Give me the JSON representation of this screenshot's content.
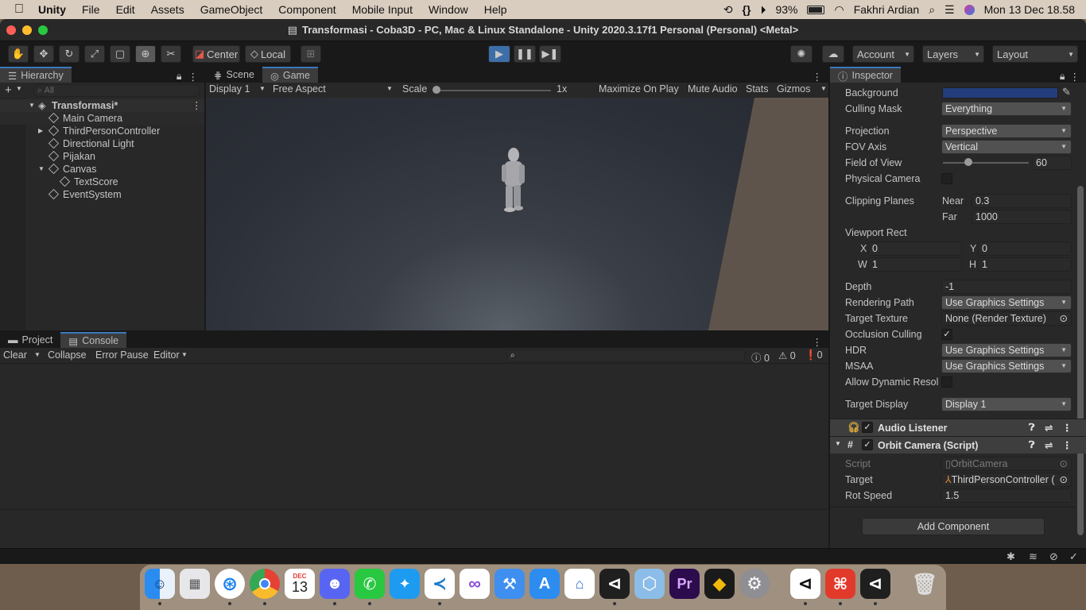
{
  "menubar": {
    "app": "Unity",
    "items": [
      "File",
      "Edit",
      "Assets",
      "GameObject",
      "Component",
      "Mobile Input",
      "Window",
      "Help"
    ],
    "battery": "93%",
    "user": "Fakhri Ardian",
    "clock": "Mon 13 Dec  18.58",
    "code_icon_glyph": "{}"
  },
  "window": {
    "title": "Transformasi - Coba3D - PC, Mac & Linux Standalone - Unity 2020.3.17f1 Personal (Personal) <Metal>"
  },
  "toolbar": {
    "pivot": "Center",
    "space": "Local",
    "account": "Account",
    "layers": "Layers",
    "layout": "Layout"
  },
  "hierarchy": {
    "tab": "Hierarchy",
    "search_placeholder": "All",
    "scene": "Transformasi*",
    "items": [
      "Main Camera",
      "ThirdPersonController",
      "Directional Light",
      "Pijakan",
      "Canvas",
      "TextScore",
      "EventSystem"
    ]
  },
  "game_view": {
    "tabs": [
      "Scene",
      "Game"
    ],
    "display": "Display 1",
    "aspect": "Free Aspect",
    "scale_label": "Scale",
    "scale_value": "1x",
    "maximize": "Maximize On Play",
    "mute": "Mute Audio",
    "stats": "Stats",
    "gizmos": "Gizmos"
  },
  "console": {
    "tabs": [
      "Project",
      "Console"
    ],
    "clear": "Clear",
    "collapse": "Collapse",
    "error_pause": "Error Pause",
    "editor": "Editor",
    "info_count": "0",
    "warn_count": "0",
    "error_count": "0"
  },
  "inspector": {
    "tab": "Inspector",
    "background_label": "Background",
    "background_color": "#233d7a",
    "culling_mask_label": "Culling Mask",
    "culling_mask": "Everything",
    "projection_label": "Projection",
    "projection": "Perspective",
    "fov_axis_label": "FOV Axis",
    "fov_axis": "Vertical",
    "fov_label": "Field of View",
    "fov": "60",
    "fov_fraction": 0.3,
    "physical_label": "Physical Camera",
    "clipping_label": "Clipping Planes",
    "near_label": "Near",
    "near": "0.3",
    "far_label": "Far",
    "far": "1000",
    "viewport_label": "Viewport Rect",
    "x_label": "X",
    "x": "0",
    "y_label": "Y",
    "y": "0",
    "w_label": "W",
    "w": "1",
    "h_label": "H",
    "h": "1",
    "depth_label": "Depth",
    "depth": "-1",
    "rendering_label": "Rendering Path",
    "rendering": "Use Graphics Settings",
    "target_texture_label": "Target Texture",
    "target_texture": "None (Render Texture)",
    "occlusion_label": "Occlusion Culling",
    "hdr_label": "HDR",
    "hdr": "Use Graphics Settings",
    "msaa_label": "MSAA",
    "msaa": "Use Graphics Settings",
    "dynres_label": "Allow Dynamic Resol",
    "target_display_label": "Target Display",
    "target_display": "Display 1",
    "audio_listener": "Audio Listener",
    "orbit_camera": "Orbit Camera (Script)",
    "script_label": "Script",
    "script": "OrbitCamera",
    "target_label": "Target",
    "target": "ThirdPersonController (",
    "rot_speed_label": "Rot Speed",
    "rot_speed": "1.5",
    "add_component": "Add Component"
  },
  "dock": {
    "calendar_month": "DEC",
    "calendar_day": "13",
    "premiere_label": "Pr"
  }
}
